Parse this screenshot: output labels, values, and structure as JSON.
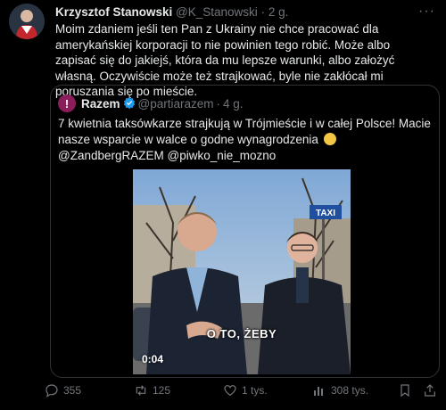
{
  "tweet": {
    "author_name": "Krzysztof Stanowski",
    "author_handle": "@K_Stanowski",
    "separator": "·",
    "time": "2 g.",
    "text": "Moim zdaniem jeśli ten Pan z Ukrainy nie chce pracować dla amerykańskiej korporacji to nie powinien tego robić. Może albo zapisać się do jakiejś, która da mu lepsze warunki, albo założyć własną. Oczywiście może też strajkować, byle nie zakłócał mi poruszania się po mieście."
  },
  "quoted": {
    "author_name": "Razem",
    "author_handle": "@partiarazem",
    "separator": "·",
    "time": "4 g.",
    "text_part1": "7 kwietnia taksówkarze strajkują w Trójmieście i w całej Polsce! Macie nasze wsparcie w walce o godne wynagrodzenia",
    "text_part2": "@ZandbergRAZEM @piwko_nie_mozno",
    "video_caption": "O TO, ŻEBY",
    "video_time": "0:04",
    "sign_text": "TAXI"
  },
  "actions": {
    "replies": "355",
    "retweets": "125",
    "likes": "1 tys.",
    "views": "308 tys."
  },
  "colors": {
    "background": "#000000",
    "text": "#e7e9ea",
    "muted": "#71767b",
    "border": "#2f3336",
    "verified": "#1d9bf0",
    "razem": "#8a1e5a"
  },
  "icons": [
    "more-icon",
    "verified-icon",
    "reply-icon",
    "retweet-icon",
    "like-icon",
    "views-icon",
    "bookmark-icon",
    "share-icon",
    "clap-emoji"
  ]
}
